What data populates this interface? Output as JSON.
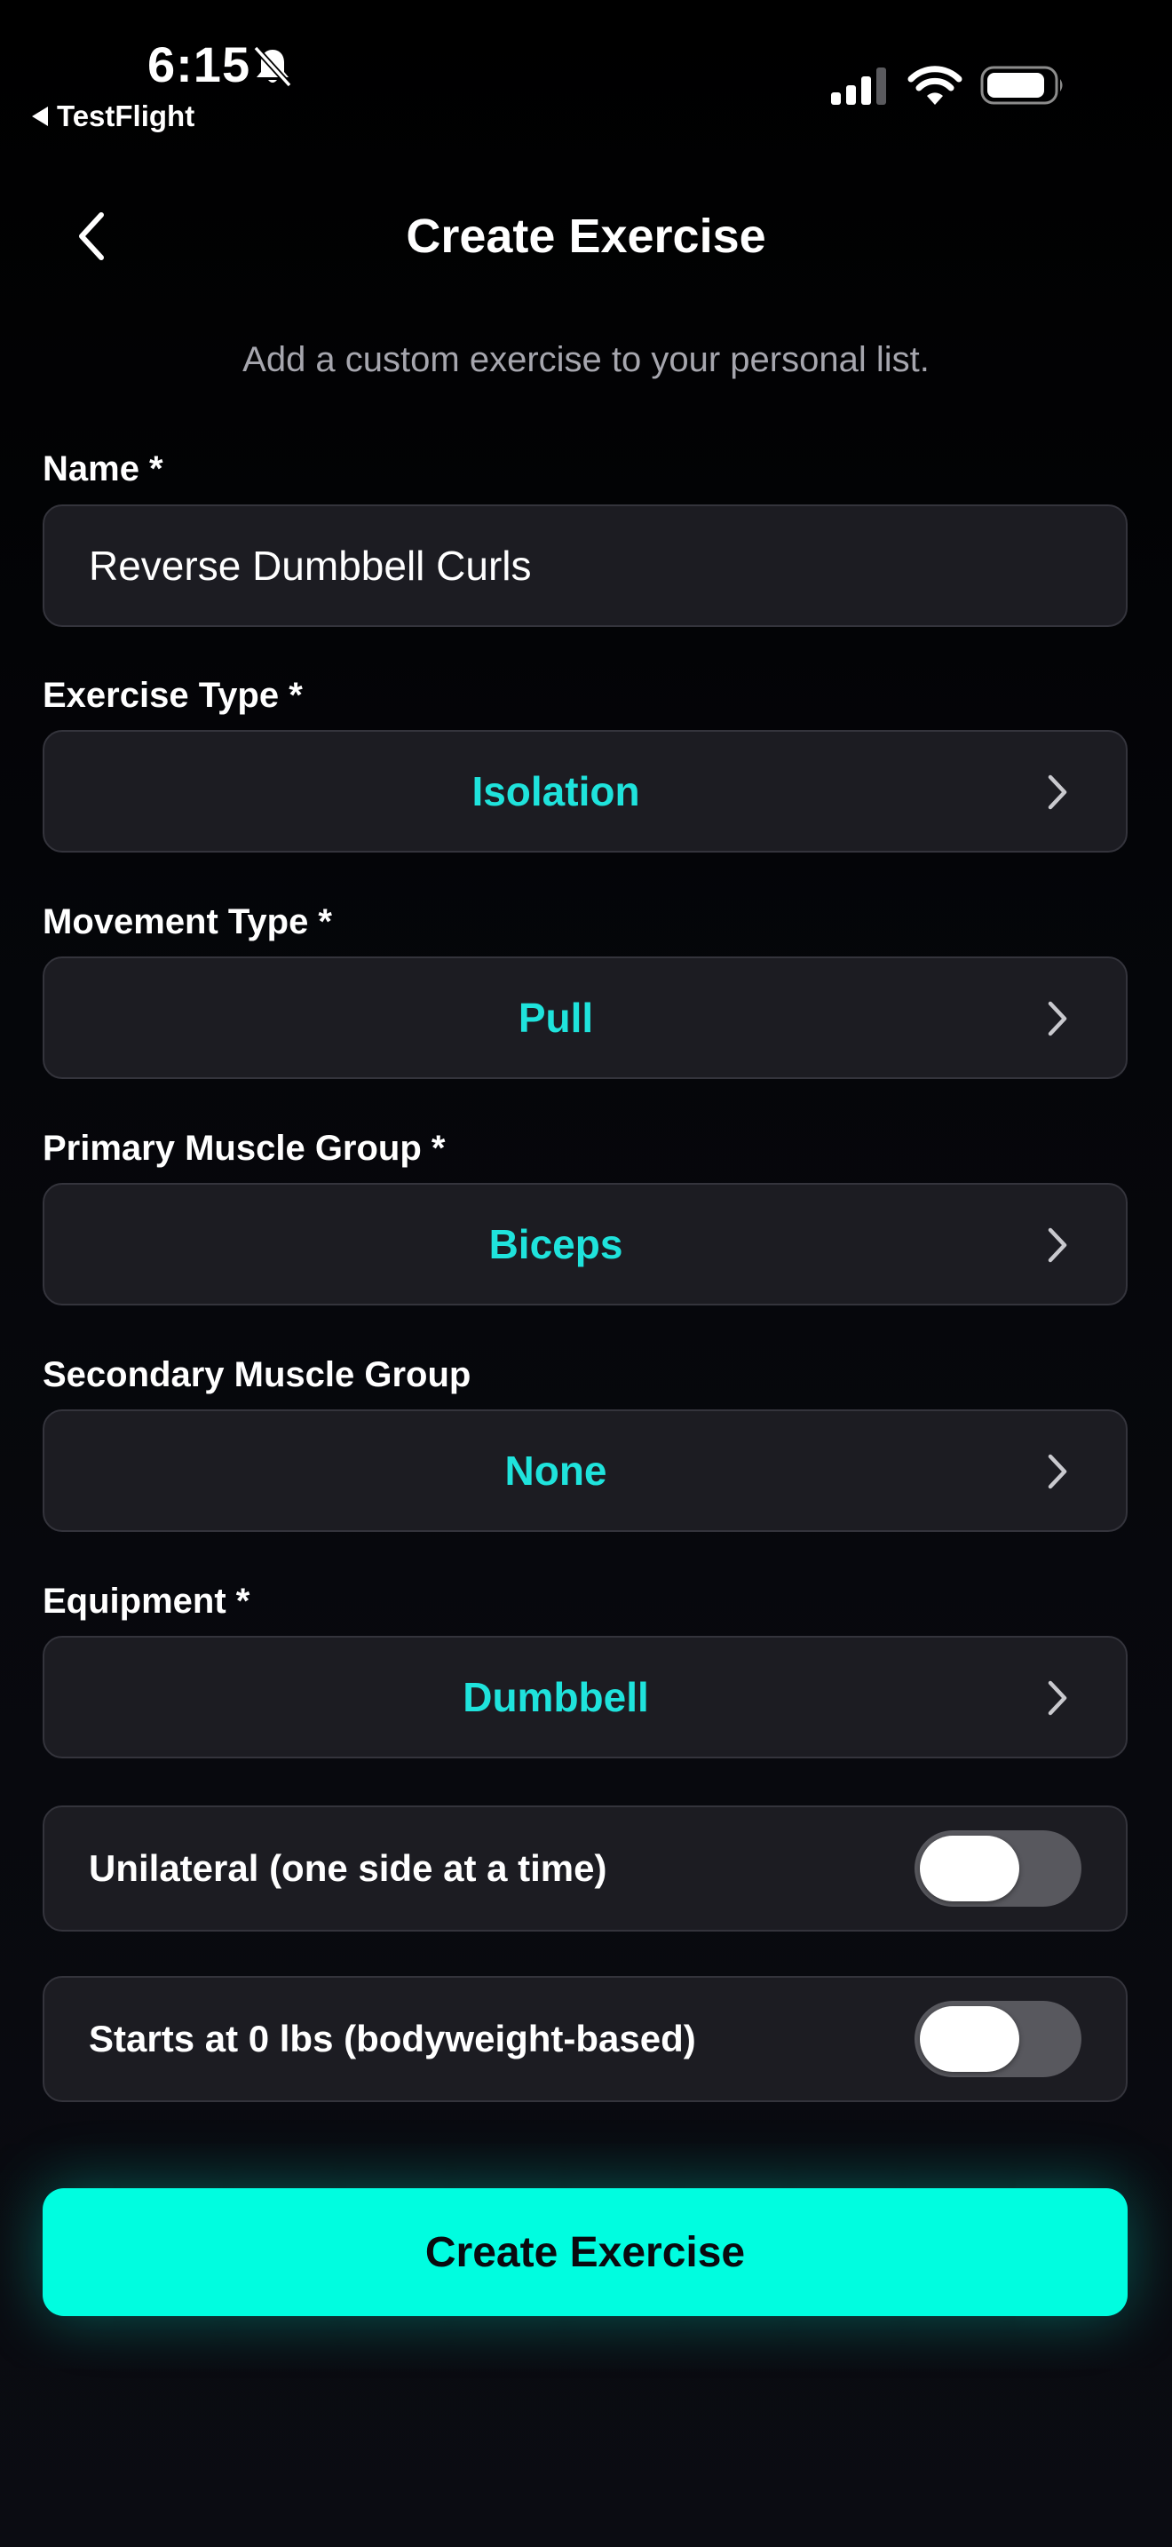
{
  "status_bar": {
    "time": "6:15",
    "back_app_label": "TestFlight"
  },
  "nav": {
    "title": "Create Exercise"
  },
  "subtitle": "Add a custom exercise to your personal list.",
  "form": {
    "name": {
      "label": "Name *",
      "value": "Reverse Dumbbell Curls"
    },
    "exercise_type": {
      "label": "Exercise Type *",
      "value": "Isolation"
    },
    "movement_type": {
      "label": "Movement Type *",
      "value": "Pull"
    },
    "primary_muscle_group": {
      "label": "Primary Muscle Group *",
      "value": "Biceps"
    },
    "secondary_muscle_group": {
      "label": "Secondary Muscle Group",
      "value": "None"
    },
    "equipment": {
      "label": "Equipment *",
      "value": "Dumbbell"
    },
    "unilateral": {
      "label": "Unilateral (one side at a time)",
      "on": false
    },
    "bodyweight": {
      "label": "Starts at 0 lbs (bodyweight-based)",
      "on": false
    }
  },
  "submit_label": "Create Exercise",
  "colors": {
    "accent": "#00fde0",
    "value_text": "#1fe3dc",
    "field_bg": "#1c1c22",
    "field_border": "#34343c",
    "toggle_off": "#58585e"
  }
}
